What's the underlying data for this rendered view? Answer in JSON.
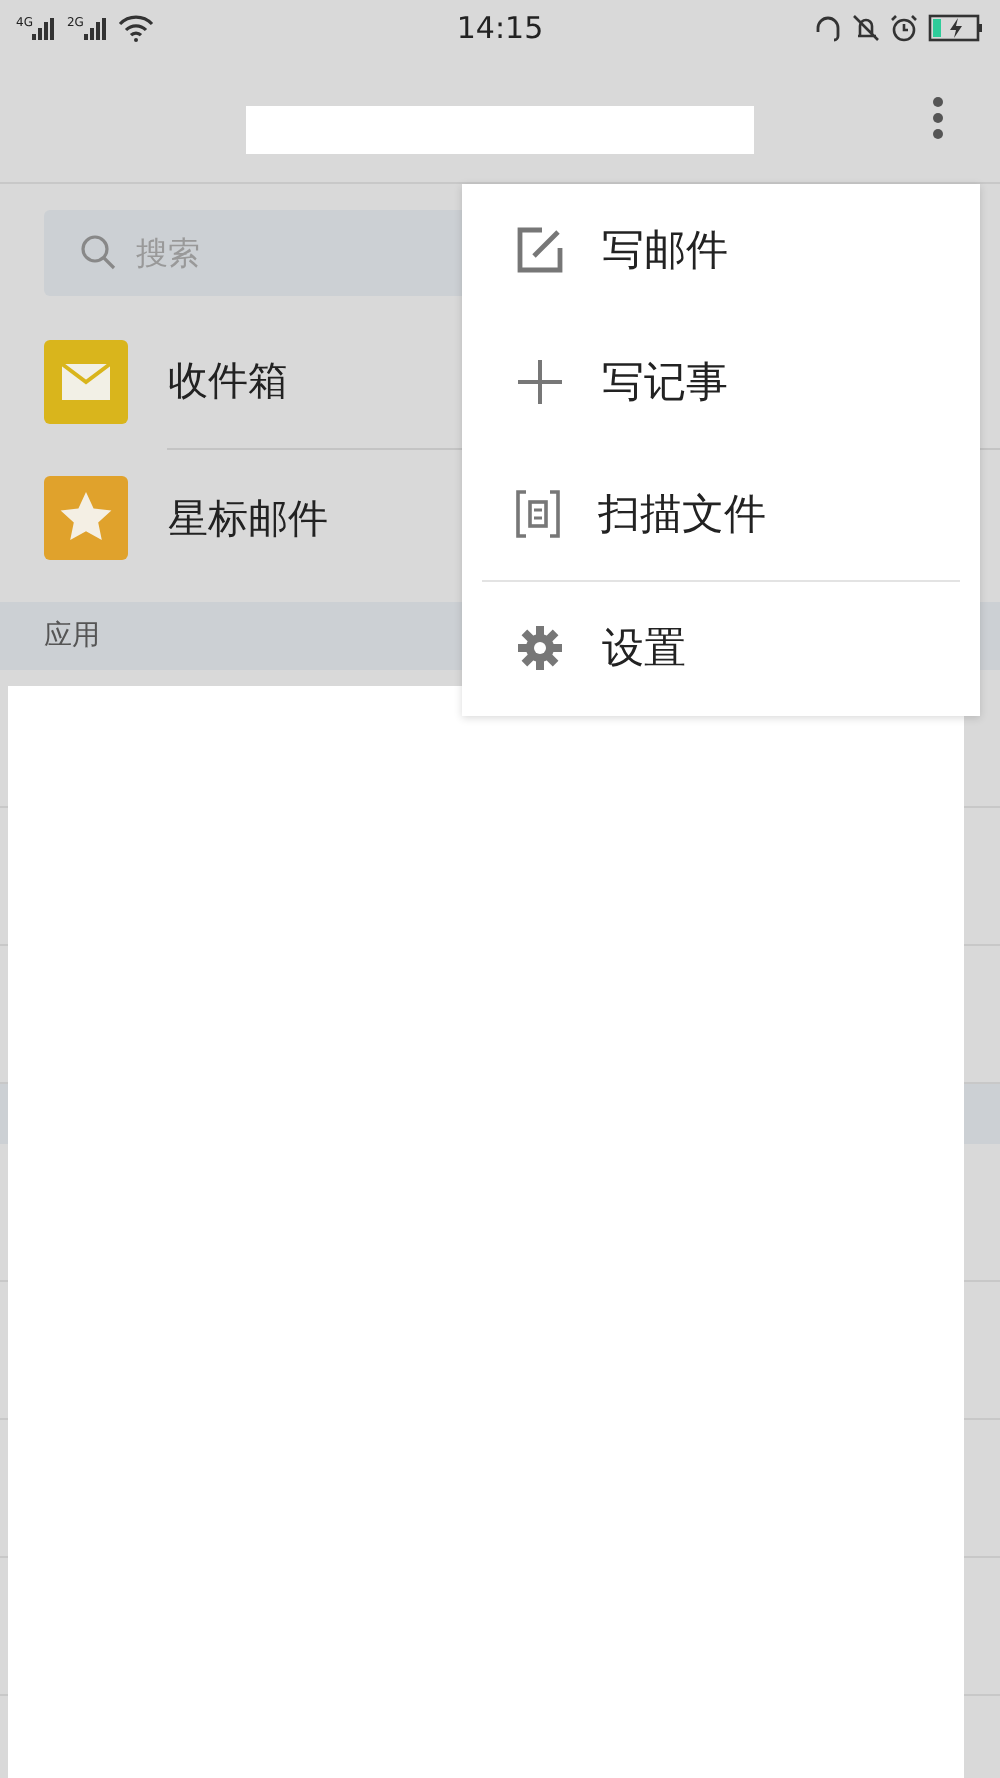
{
  "status_bar": {
    "networks": [
      "4G",
      "2G"
    ],
    "time": "14:15"
  },
  "search": {
    "placeholder": "搜索"
  },
  "folders": [
    {
      "label": "收件箱",
      "kind": "inbox"
    },
    {
      "label": "星标邮件",
      "kind": "starred"
    }
  ],
  "section": {
    "title": "应用"
  },
  "menu": {
    "items": [
      {
        "label": "写邮件",
        "kind": "compose"
      },
      {
        "label": "写记事",
        "kind": "note"
      },
      {
        "label": "扫描文件",
        "kind": "scan"
      },
      {
        "label": "设置",
        "kind": "settings"
      }
    ]
  }
}
